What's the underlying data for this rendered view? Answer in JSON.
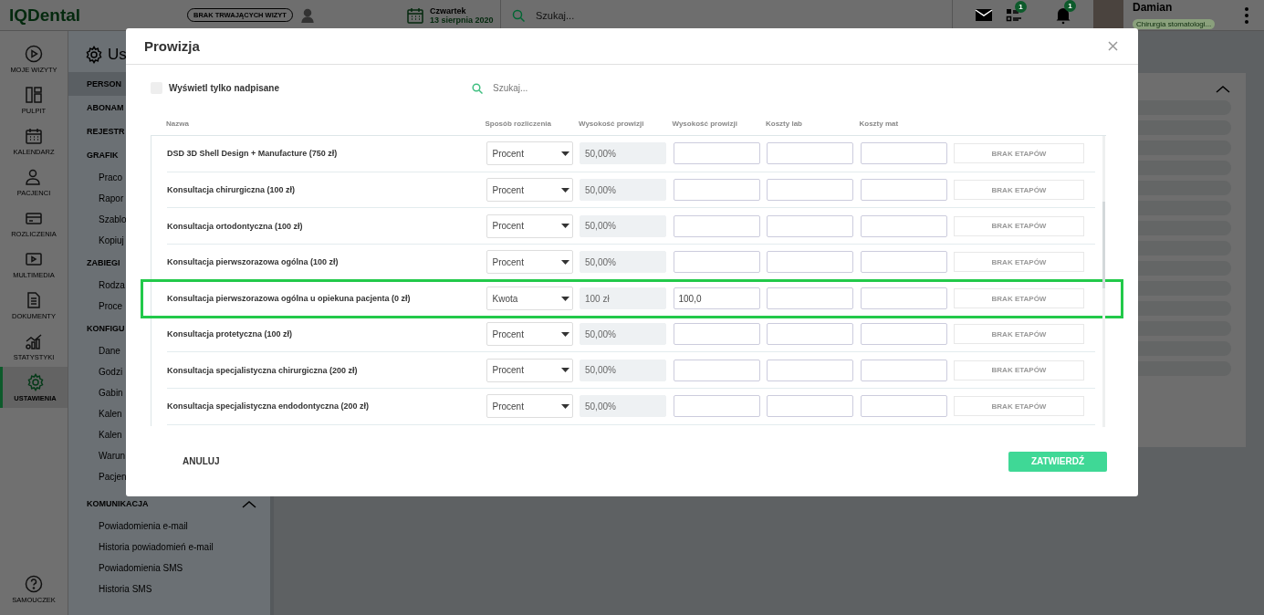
{
  "topbar": {
    "logo": "IQDental",
    "visit_status": "BRAK TRWAJĄCYCH WIZYT",
    "day": "Czwartek",
    "date": "13 sierpnia 2020",
    "search": {
      "placeholder": "Szukaj..."
    },
    "tasks_badge": "1",
    "notifications_badge": "1",
    "user": {
      "name": "Damian",
      "role": "Chirurgia stomatologi..."
    }
  },
  "nav": [
    {
      "label": "MOJE WIZYTY",
      "selected": false
    },
    {
      "label": "PULPIT",
      "selected": false
    },
    {
      "label": "KALENDARZ",
      "selected": false
    },
    {
      "label": "PACJENCI",
      "selected": false
    },
    {
      "label": "ROZLICZENIA",
      "selected": false
    },
    {
      "label": "MULTIMEDIA",
      "selected": false
    },
    {
      "label": "DOKUMENTY",
      "selected": false
    },
    {
      "label": "STATYSTYKI",
      "selected": false
    },
    {
      "label": "USTAWIENIA",
      "selected": true
    }
  ],
  "nav_bottom": {
    "label": "SAMOUCZEK"
  },
  "settings_sidebar": {
    "title": "Us",
    "sections": [
      {
        "label": "PERSON",
        "selected": true
      },
      {
        "label": "ABONAM",
        "selected": false
      },
      {
        "label": "REJESTR",
        "selected": false
      },
      {
        "label": "GRAFIK",
        "selected": false,
        "items": [
          "Praco",
          "Rapor",
          "Szablo",
          "Kopiuj"
        ]
      },
      {
        "label": "ZABIEGI",
        "selected": false,
        "items": [
          "Rodza",
          "Proce"
        ]
      },
      {
        "label": "KONFIGU",
        "selected": false,
        "items": [
          "Dane",
          "Godzi",
          "Gabin",
          "Kalen",
          "Kalen",
          "Warun",
          "Pacjen"
        ]
      },
      {
        "label": "KOMUNIKACJA",
        "selected": false,
        "expanded": true,
        "items": [
          "Powiadomienia e-mail",
          "Historia powiadomień e-mail",
          "Powiadomienia SMS",
          "Historia SMS"
        ]
      }
    ]
  },
  "modal": {
    "title": "Prowizja",
    "filter": {
      "label": "Wyświetl tylko nadpisane",
      "checked": false
    },
    "search": {
      "placeholder": "Szukaj..."
    },
    "table": {
      "columns": [
        "Nazwa",
        "Sposób rozliczenia",
        "Wysokość prowizji",
        "Wysokość prowizji",
        "Koszty lab",
        "Koszty mat"
      ],
      "rows": [
        {
          "name": "DSD 3D Shell Design + Manufacture (750 zł)",
          "method": "Procent",
          "rate": "50,00%",
          "stages": {
            "label": "BRAK ETAPÓW",
            "disabled": true
          },
          "highlighted": false
        },
        {
          "name": "Konsultacja chirurgiczna (100 zł)",
          "method": "Procent",
          "rate": "50,00%",
          "stages": {
            "label": "BRAK ETAPÓW",
            "disabled": true
          },
          "highlighted": false
        },
        {
          "name": "Konsultacja ortodontyczna (100 zł)",
          "method": "Procent",
          "rate": "50,00%",
          "stages": {
            "label": "BRAK ETAPÓW",
            "disabled": true
          },
          "highlighted": false
        },
        {
          "name": "Konsultacja pierwszorazowa ogólna (100 zł)",
          "method": "Procent",
          "rate": "50,00%",
          "stages": {
            "label": "BRAK ETAPÓW",
            "disabled": true
          },
          "highlighted": false
        },
        {
          "name": "Konsultacja pierwszorazowa ogólna u opiekuna pacjenta (0 zł)",
          "method": "Kwota",
          "rate": "100 zł",
          "amount": "100,0",
          "stages": {
            "label": "BRAK ETAPÓW",
            "disabled": true
          },
          "highlighted": true
        },
        {
          "name": "Konsultacja protetyczna (100 zł)",
          "method": "Procent",
          "rate": "50,00%",
          "stages": {
            "label": "BRAK ETAPÓW",
            "disabled": true
          },
          "highlighted": false
        },
        {
          "name": "Konsultacja specjalistyczna chirurgiczna (200 zł)",
          "method": "Procent",
          "rate": "50,00%",
          "stages": {
            "label": "BRAK ETAPÓW",
            "disabled": true
          },
          "highlighted": false
        },
        {
          "name": "Konsultacja specjalistyczna endodontyczna (200 zł)",
          "method": "Procent",
          "rate": "50,00%",
          "stages": {
            "label": "BRAK ETAPÓW",
            "disabled": true
          },
          "highlighted": false
        }
      ]
    },
    "cancel": "ANULUJ",
    "confirm": "ZATWIERDŹ"
  }
}
